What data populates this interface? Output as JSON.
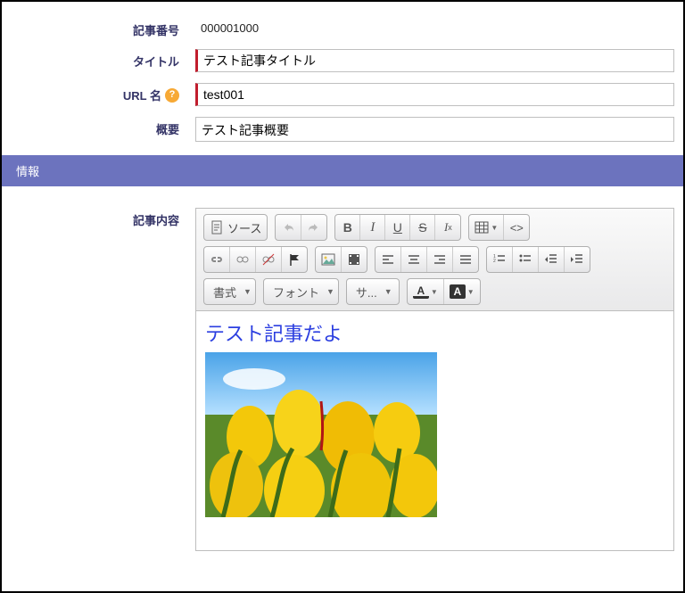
{
  "fields": {
    "article_number": {
      "label": "記事番号",
      "value": "000001000"
    },
    "title": {
      "label": "タイトル",
      "value": "テスト記事タイトル"
    },
    "url_name": {
      "label": "URL 名",
      "value": "test001"
    },
    "summary": {
      "label": "概要",
      "value": "テスト記事概要"
    }
  },
  "section": {
    "info": "情報"
  },
  "content": {
    "label": "記事内容",
    "heading_text": "テスト記事だよ"
  },
  "toolbar": {
    "source": "ソース",
    "format": "書式",
    "font": "フォント",
    "size": "サ..."
  }
}
